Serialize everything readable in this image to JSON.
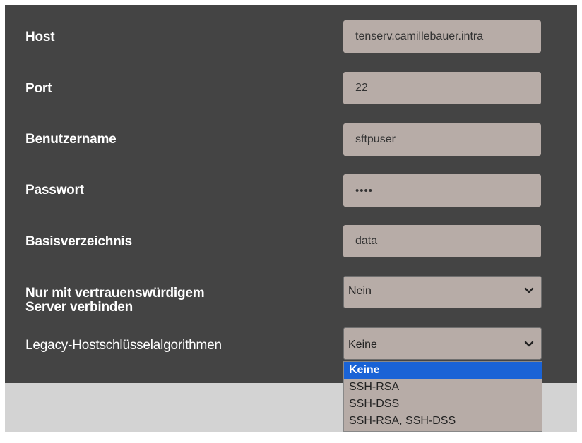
{
  "form": {
    "host_label": "Host",
    "host_value": "tenserv.camillebauer.intra",
    "port_label": "Port",
    "port_value": "22",
    "user_label": "Benutzername",
    "user_value": "sftpuser",
    "password_label": "Passwort",
    "password_value": "••••",
    "basedir_label": "Basisverzeichnis",
    "basedir_value": "data",
    "trusted_label_line1": "Nur mit vertrauenswürdigem",
    "trusted_label_line2": "Server verbinden",
    "trusted_value": "Nein",
    "legacy_label": "Legacy-Hostschlüsselalgorithmen",
    "legacy_value": "Keine"
  },
  "legacy_options": [
    "Keine",
    "SSH-RSA",
    "SSH-DSS",
    "SSH-RSA, SSH-DSS"
  ],
  "icons": {
    "select_chevron": "chevron-down-icon"
  },
  "colors": {
    "panel_bg": "#444444",
    "field_bg": "#b7aca7",
    "selected_option_bg": "#1a63d6",
    "footer_bg": "#d3d3d3"
  }
}
